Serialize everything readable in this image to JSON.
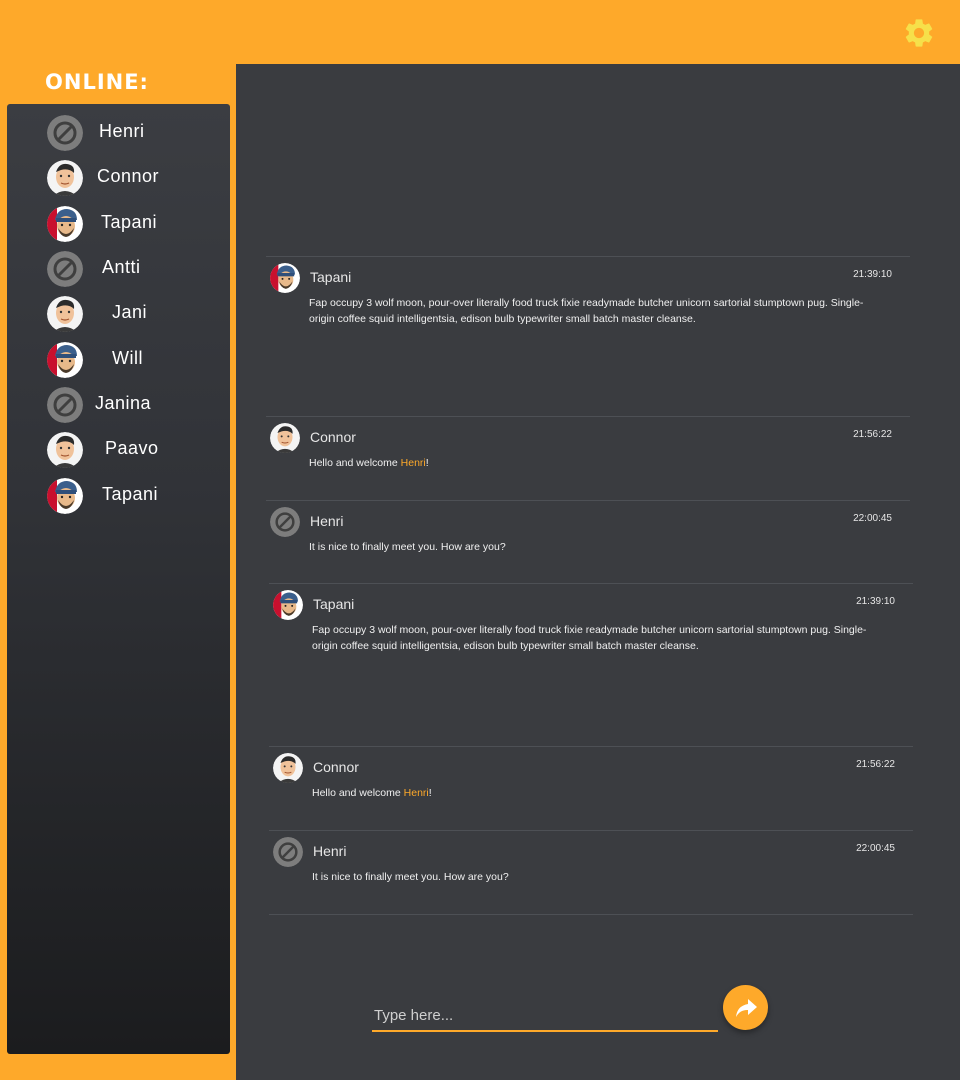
{
  "header": {
    "settings_icon": "gear-icon",
    "accent": "#fea92a"
  },
  "sidebar": {
    "title": "ONLINE:",
    "users": [
      {
        "name": "Henri",
        "avatar": "default"
      },
      {
        "name": "Connor",
        "avatar": "connor"
      },
      {
        "name": "Tapani",
        "avatar": "tapani"
      },
      {
        "name": "Antti",
        "avatar": "default"
      },
      {
        "name": "Jani",
        "avatar": "connor"
      },
      {
        "name": "Will",
        "avatar": "tapani"
      },
      {
        "name": "Janina",
        "avatar": "default"
      },
      {
        "name": "Paavo",
        "avatar": "connor"
      },
      {
        "name": "Tapani",
        "avatar": "tapani"
      }
    ]
  },
  "messages": [
    {
      "author": "Tapani",
      "time": "21:39:10",
      "text": "Fap occupy 3 wolf moon, pour-over literally food truck fixie readymade butcher unicorn sartorial stumptown pug. Single-origin coffee squid intelligentsia, edison bulb typewriter small batch master cleanse."
    },
    {
      "author": "Connor",
      "time": "21:56:22",
      "text_before": "Hello and welcome ",
      "mention": "Henri",
      "text_after": "!"
    },
    {
      "author": "Henri",
      "time": "22:00:45",
      "text": "It is nice to finally meet you. How are you?"
    },
    {
      "author": "Tapani",
      "time": "21:39:10",
      "text": "Fap occupy 3 wolf moon, pour-over literally food truck fixie readymade butcher unicorn sartorial stumptown pug. Single-origin coffee squid intelligentsia, edison bulb typewriter small batch master cleanse."
    },
    {
      "author": "Connor",
      "time": "21:56:22",
      "text_before": "Hello and welcome ",
      "mention": "Henri",
      "text_after": "!"
    },
    {
      "author": "Henri",
      "time": "22:00:45",
      "text": "It is nice to finally meet you. How are you?"
    }
  ],
  "composer": {
    "placeholder": "Type here...",
    "send_icon": "share-arrow-icon"
  }
}
